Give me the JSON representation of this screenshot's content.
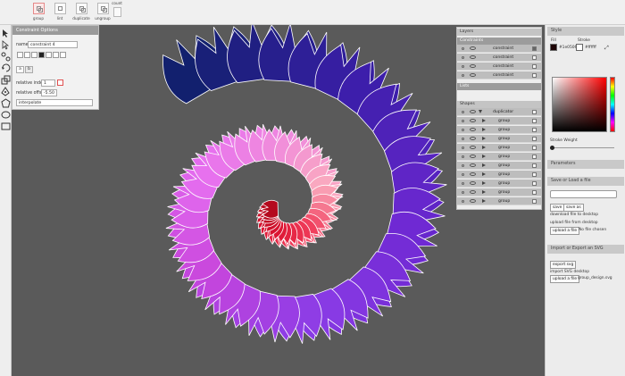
{
  "toolbar": {
    "buttons": [
      {
        "label": "group"
      },
      {
        "label": "lint"
      },
      {
        "label": "duplicate"
      },
      {
        "label": "ungroup"
      },
      {
        "label": "count"
      }
    ]
  },
  "constraint_panel": {
    "title": "Constraint Options",
    "name_label": "name",
    "name_value": "constraint 4",
    "tab_a": "a",
    "tab_b": "b",
    "relative_index_label": "relative index",
    "relative_index_value": "1",
    "relative_offset_label": "relative offset",
    "relative_offset_value": "-5.50",
    "mode_value": "interpolate"
  },
  "layers": {
    "title": "Layers",
    "constraints_header": "Constraints",
    "constraints": [
      "constraint",
      "constraint",
      "constraint",
      "constraint"
    ],
    "lists_header": "Lists",
    "shapes_header": "Shapes",
    "duplicator": "duplicator",
    "groups": [
      "group",
      "group",
      "group",
      "group",
      "group",
      "group",
      "group",
      "group",
      "group",
      "group"
    ]
  },
  "style": {
    "title": "Style",
    "fill_label": "Fill",
    "stroke_label": "Stroke",
    "fill_hex": "#1e0506",
    "stroke_hex": "#ffffff",
    "stroke_weight_label": "Stroke Weight"
  },
  "parameters": {
    "title": "Parameters"
  },
  "save_load": {
    "title": "Save or Load a file",
    "save": "save",
    "save_as": "save as",
    "download": "download file to desktop",
    "upload": "upload file from desktop",
    "upload_btn": "upload a file",
    "no_file": "No file chosen"
  },
  "import_export": {
    "title": "Import or Export an SVG",
    "export_btn": "export svg",
    "import_text": "import SVG desktop",
    "upload_btn": "upload a file",
    "file_name": "group_design.svg"
  }
}
